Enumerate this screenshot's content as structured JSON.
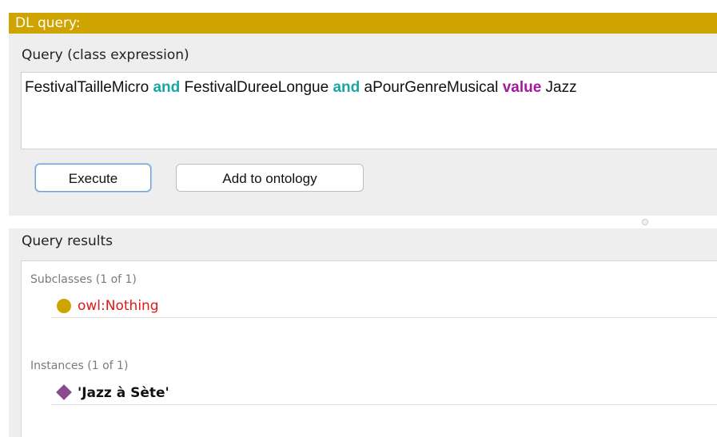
{
  "title_bar": {
    "label": "DL query:"
  },
  "query": {
    "section_label": "Query (class expression)",
    "expression": [
      {
        "text": "FestivalTailleMicro ",
        "kind": "class"
      },
      {
        "text": "and",
        "kind": "keyword-and"
      },
      {
        "text": " FestivalDureeLongue ",
        "kind": "class"
      },
      {
        "text": "and",
        "kind": "keyword-and"
      },
      {
        "text": " aPourGenreMusical ",
        "kind": "property"
      },
      {
        "text": "value",
        "kind": "keyword-value"
      },
      {
        "text": " Jazz",
        "kind": "individual"
      }
    ],
    "execute_label": "Execute",
    "add_label": "Add to ontology"
  },
  "results": {
    "section_label": "Query results",
    "subclasses": {
      "header": "Subclasses (1 of 1)",
      "items": [
        {
          "label": "owl:Nothing",
          "icon": "class-icon"
        }
      ]
    },
    "instances": {
      "header": "Instances (1 of 1)",
      "items": [
        {
          "label": "'Jazz à Sète'",
          "icon": "individual-icon"
        }
      ]
    }
  },
  "colors": {
    "title_bar_bg": "#cfa300",
    "keyword_and": "#1aa6a6",
    "keyword_value": "#a3189e",
    "nothing_text": "#e01818",
    "class_icon": "#cfa300",
    "individual_icon": "#8a4a90"
  }
}
